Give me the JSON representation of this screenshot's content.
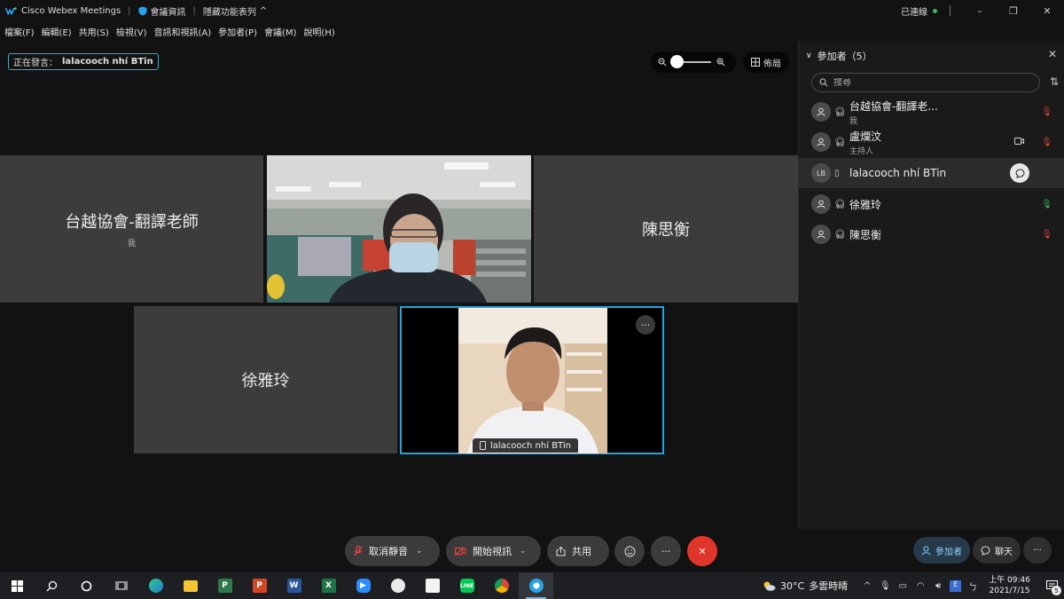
{
  "titlebar": {
    "app_name": "Cisco Webex Meetings",
    "meeting_info": "會議資訊",
    "hide_menu": "隱藏功能表列",
    "status": "已連線"
  },
  "menu": [
    "檔案(F)",
    "編輯(E)",
    "共用(S)",
    "檢視(V)",
    "音訊和視訊(A)",
    "參加者(P)",
    "會議(M)",
    "說明(H)"
  ],
  "speaking": {
    "label": "正在發言：",
    "name": "lalacooch nhí BTin"
  },
  "layout_label": "佈局",
  "tiles": [
    {
      "name": "台越協會-翻譯老師",
      "sub": "我"
    },
    {
      "name": "陳思衡"
    },
    {
      "name": "徐雅玲"
    },
    {
      "name": "lalacooch nhí BTin"
    }
  ],
  "controls": {
    "unmute": "取消靜音",
    "start_video": "開始視訊",
    "share": "共用"
  },
  "panel": {
    "title": "參加者（5）",
    "search_placeholder": "搜尋",
    "participants": [
      {
        "initials": "",
        "name": "台越協會-翻譯老...",
        "role": "我",
        "mic": "off"
      },
      {
        "initials": "",
        "name": "盧爛汶",
        "role": "主持人",
        "mic": "off"
      },
      {
        "initials": "LB",
        "name": "lalacooch nhí BTin",
        "role": "",
        "mic": "none"
      },
      {
        "initials": "",
        "name": "徐雅玲",
        "role": "",
        "mic": "on"
      },
      {
        "initials": "",
        "name": "陳思衡",
        "role": "",
        "mic": "off"
      }
    ]
  },
  "panel_footer": {
    "participants": "參加者",
    "chat": "聊天"
  },
  "taskbar": {
    "weather_temp": "30°C",
    "weather_desc": "多雲時晴",
    "time": "上午 09:46",
    "date": "2021/7/15",
    "notif_count": "5"
  },
  "colors": {
    "accent": "#21a6dd",
    "mic_off": "#e2453c",
    "mic_on": "#3bbf5b",
    "end_call": "#e0352b"
  }
}
